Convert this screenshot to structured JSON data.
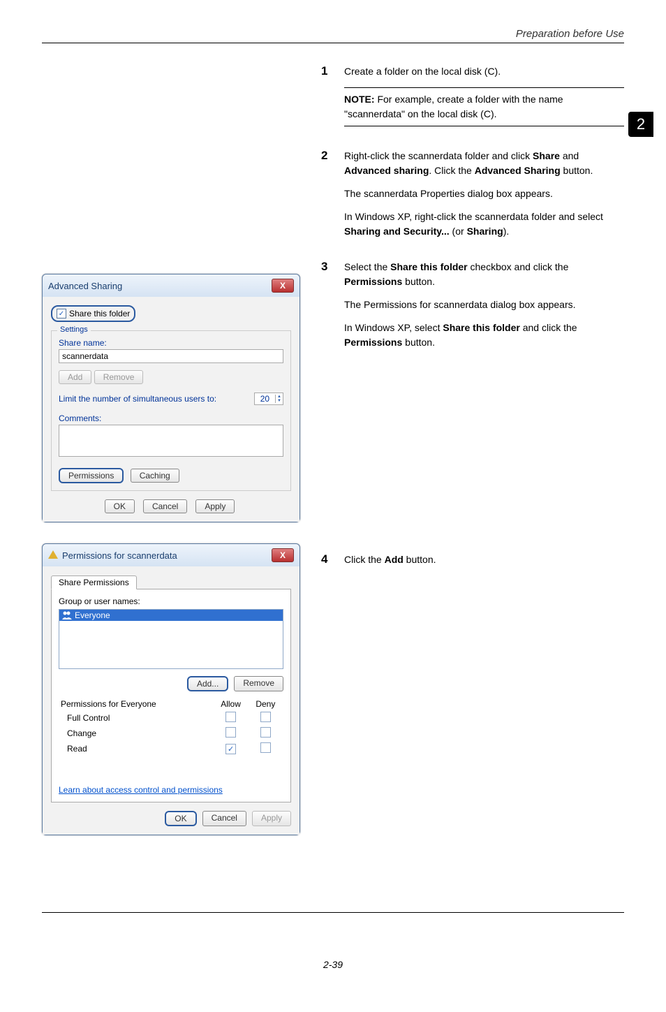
{
  "header": {
    "title": "Preparation before Use"
  },
  "sidetab": "2",
  "steps": {
    "s1": {
      "num": "1",
      "text": "Create a folder on the local disk (C)."
    },
    "note": {
      "label": "NOTE:",
      "text": " For example, create a folder with the name \"scannerdata\" on the local disk (C)."
    },
    "s2": {
      "num": "2",
      "t1a": "Right-click the scannerdata folder and click ",
      "t1b": "Share",
      "t1c": " and ",
      "t1d": "Advanced sharing",
      "t1e": ". Click the ",
      "t1f": "Advanced Sharing",
      "t1g": " button.",
      "t2": "The scannerdata Properties dialog box appears.",
      "t3a": "In Windows XP, right-click the scannerdata folder and select ",
      "t3b": "Sharing and Security...",
      "t3c": " (or ",
      "t3d": "Sharing",
      "t3e": ")."
    },
    "s3": {
      "num": "3",
      "t1a": "Select the ",
      "t1b": "Share this folder",
      "t1c": " checkbox and click the ",
      "t1d": "Permissions",
      "t1e": " button.",
      "t2": "The Permissions for scannerdata dialog box appears.",
      "t3a": "In Windows XP, select ",
      "t3b": "Share this folder",
      "t3c": " and click the ",
      "t3d": "Permissions",
      "t3e": " button."
    },
    "s4": {
      "num": "4",
      "t1a": "Click the ",
      "t1b": "Add",
      "t1c": " button."
    }
  },
  "dlg1": {
    "title": "Advanced Sharing",
    "share_chk": "Share this folder",
    "settings": "Settings",
    "share_name_lbl": "Share name:",
    "share_name_val": "scannerdata",
    "add": "Add",
    "remove": "Remove",
    "limit_lbl": "Limit the number of simultaneous users to:",
    "limit_val": "20",
    "comments_lbl": "Comments:",
    "permissions": "Permissions",
    "caching": "Caching",
    "ok": "OK",
    "cancel": "Cancel",
    "apply": "Apply"
  },
  "dlg2": {
    "title": "Permissions for scannerdata",
    "tab": "Share Permissions",
    "group_lbl": "Group or user names:",
    "everyone": "Everyone",
    "add": "Add...",
    "remove": "Remove",
    "perm_for": "Permissions for Everyone",
    "allow": "Allow",
    "deny": "Deny",
    "full": "Full Control",
    "change": "Change",
    "read": "Read",
    "learn": "Learn about access control and permissions",
    "ok": "OK",
    "cancel": "Cancel",
    "apply": "Apply"
  },
  "footer": "2-39"
}
